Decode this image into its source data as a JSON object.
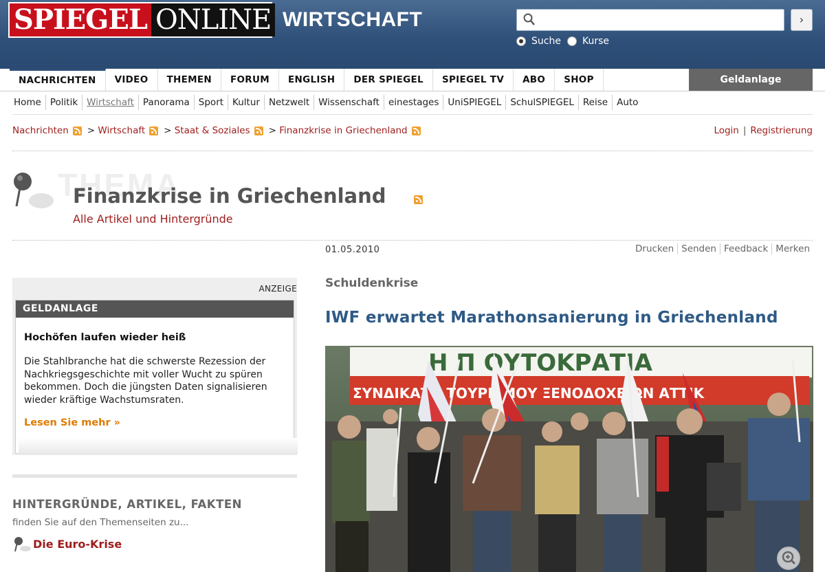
{
  "brand": {
    "logo_red": "SPIEGEL",
    "logo_black": "ONLINE",
    "section": "WIRTSCHAFT"
  },
  "search": {
    "placeholder": "",
    "options": [
      "Suche",
      "Kurse"
    ],
    "selected": "Suche"
  },
  "main_nav": [
    "NACHRICHTEN",
    "VIDEO",
    "THEMEN",
    "FORUM",
    "ENGLISH",
    "DER SPIEGEL",
    "SPIEGEL TV",
    "ABO",
    "SHOP"
  ],
  "geldanlage_tab": "Geldanlage",
  "sub_nav": [
    "Home",
    "Politik",
    "Wirtschaft",
    "Panorama",
    "Sport",
    "Kultur",
    "Netzwelt",
    "Wissenschaft",
    "einestages",
    "UniSPIEGEL",
    "SchulSPIEGEL",
    "Reise",
    "Auto"
  ],
  "breadcrumb": [
    "Nachrichten",
    "Wirtschaft",
    "Staat & Soziales",
    "Finanzkrise in Griechenland"
  ],
  "breadcrumb_sep": ">",
  "account": {
    "login": "Login",
    "sep": "|",
    "register": "Registrierung"
  },
  "thema": {
    "label": "THEMA",
    "title": "Finanzkrise in Griechenland",
    "subtitle": "Alle Artikel und Hintergründe"
  },
  "ad": {
    "label": "ANZEIGE",
    "header": "GELDANLAGE",
    "title": "Hochöfen laufen wieder heiß",
    "text": "Die Stahlbranche hat die schwerste Rezession der Nachkriegsgeschichte mit voller Wucht zu spüren bekommen. Doch die jüngsten Daten signalisieren wieder kräftige Wachstumsraten.",
    "more": "Lesen Sie mehr »"
  },
  "background": {
    "title": "HINTERGRÜNDE, ARTIKEL, FAKTEN",
    "subtitle": "finden Sie auf den Themenseiten zu...",
    "link": "Die Euro-Krise"
  },
  "article": {
    "date": "01.05.2010",
    "tools": [
      "Drucken",
      "Senden",
      "Feedback",
      "Merken"
    ],
    "kicker": "Schuldenkrise",
    "headline": "IWF erwartet Marathonsanierung in Griechenland",
    "banner_top": "Η Π ΟΥΤΟΚΡΑΤΙΑ",
    "banner_bottom": "ΣΥΝΔΙΚΑΤΟ ΤΟΥΡΙΣΜΟΥ ΞΕΝΟΔΟΧΕΙΩΝ ΑΤΤΙΚ"
  },
  "colors": {
    "header_blue": "#2e4f78",
    "brand_red": "#c8101c",
    "link_red": "#9e1c1c",
    "headline_blue": "#2e5a86",
    "orange": "#e07b00"
  }
}
